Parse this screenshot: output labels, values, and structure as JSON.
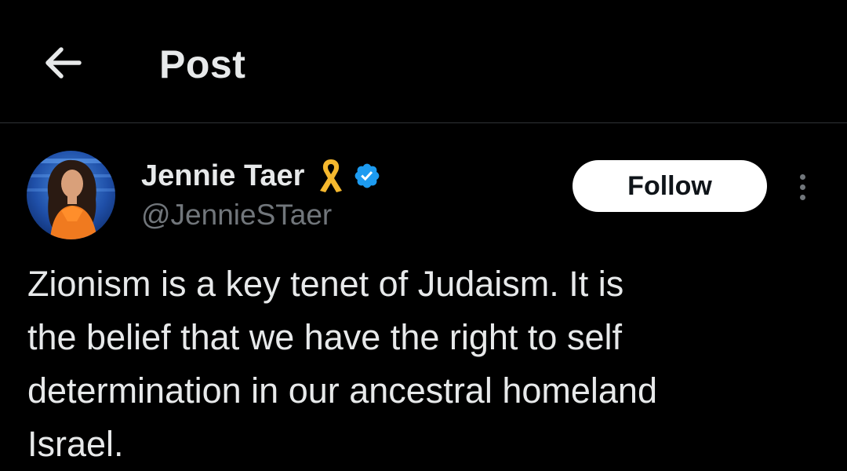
{
  "header": {
    "back_icon": "arrow-left-icon",
    "title": "Post"
  },
  "post": {
    "author": {
      "display_name": "Jennie Taer",
      "ribbon_icon": "yellow-ribbon-icon",
      "verified_icon": "verified-badge-icon",
      "handle": "@JennieSTaer"
    },
    "follow_label": "Follow",
    "more_icon": "more-options-icon",
    "text": "Zionism is a key tenet of Judaism. It is\nthe belief that we have the right to self\ndetermination in our ancestral homeland\nIsrael."
  },
  "colors": {
    "background": "#000000",
    "text_primary": "#e7e9ea",
    "text_secondary": "#71767b",
    "divider": "#2f3336",
    "verified_blue": "#1d9bf0",
    "ribbon_yellow": "#f5b82e",
    "follow_bg": "#ffffff"
  }
}
